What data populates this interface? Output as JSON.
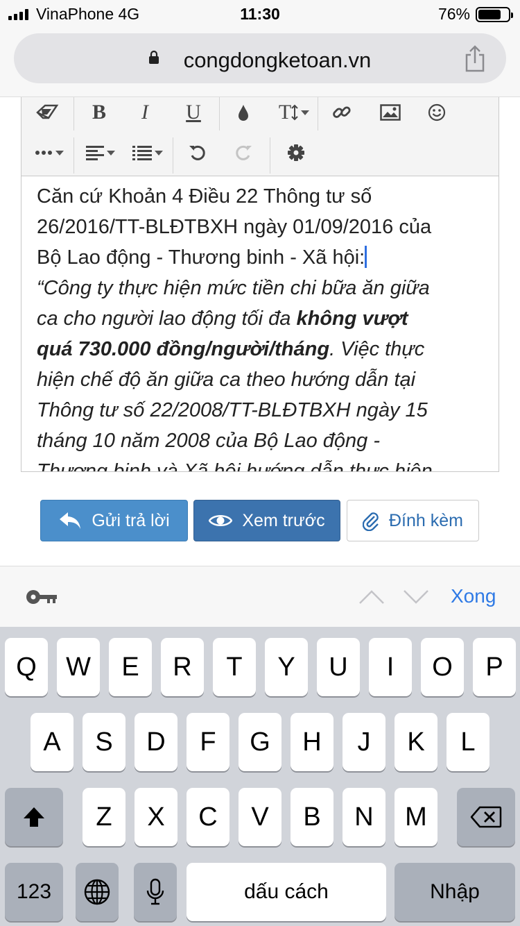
{
  "status_bar": {
    "carrier": "VinaPhone   4G",
    "time": "11:30",
    "battery": "76%"
  },
  "browser": {
    "url": "congdongketoan.vn"
  },
  "editor": {
    "toolbar": {
      "bold": "B",
      "italic": "I",
      "underline": "U",
      "font_size": "T"
    },
    "content": {
      "p1_line1": "Căn cứ Khoản 4 Điều 22 Thông tư số",
      "p1_line2": "26/2016/TT-BLĐTBXH ngày 01/09/2016 của",
      "p1_line3": "Bộ Lao động - Thương binh - Xã hội:",
      "q_line1": "“Công ty thực hiện mức tiền chi bữa ăn giữa",
      "q_line2a": "ca cho người lao động tối đa ",
      "q_bold1": "không vượt",
      "q_bold2": "quá 730.000 đồng/người/tháng",
      "q_line3b": ". Việc thực",
      "q_line4": "hiện chế độ ăn giữa ca theo hướng dẫn tại",
      "q_line5": "Thông tư số 22/2008/TT-BLĐTBXH ngày 15",
      "q_line6": "tháng 10 năm 2008 của Bộ Lao động -",
      "q_line7": "Thương binh và Xã hội hướng dẫn thực hiện"
    }
  },
  "actions": {
    "reply": "Gửi trả lời",
    "preview": "Xem trước",
    "attach": "Đính kèm"
  },
  "accessory": {
    "done": "Xong"
  },
  "keyboard": {
    "row1": [
      "Q",
      "W",
      "E",
      "R",
      "T",
      "Y",
      "U",
      "I",
      "O",
      "P"
    ],
    "row2": [
      "A",
      "S",
      "D",
      "F",
      "G",
      "H",
      "J",
      "K",
      "L"
    ],
    "row3": [
      "Z",
      "X",
      "C",
      "V",
      "B",
      "N",
      "M"
    ],
    "numbers": "123",
    "space": "dấu cách",
    "return": "Nhập"
  }
}
